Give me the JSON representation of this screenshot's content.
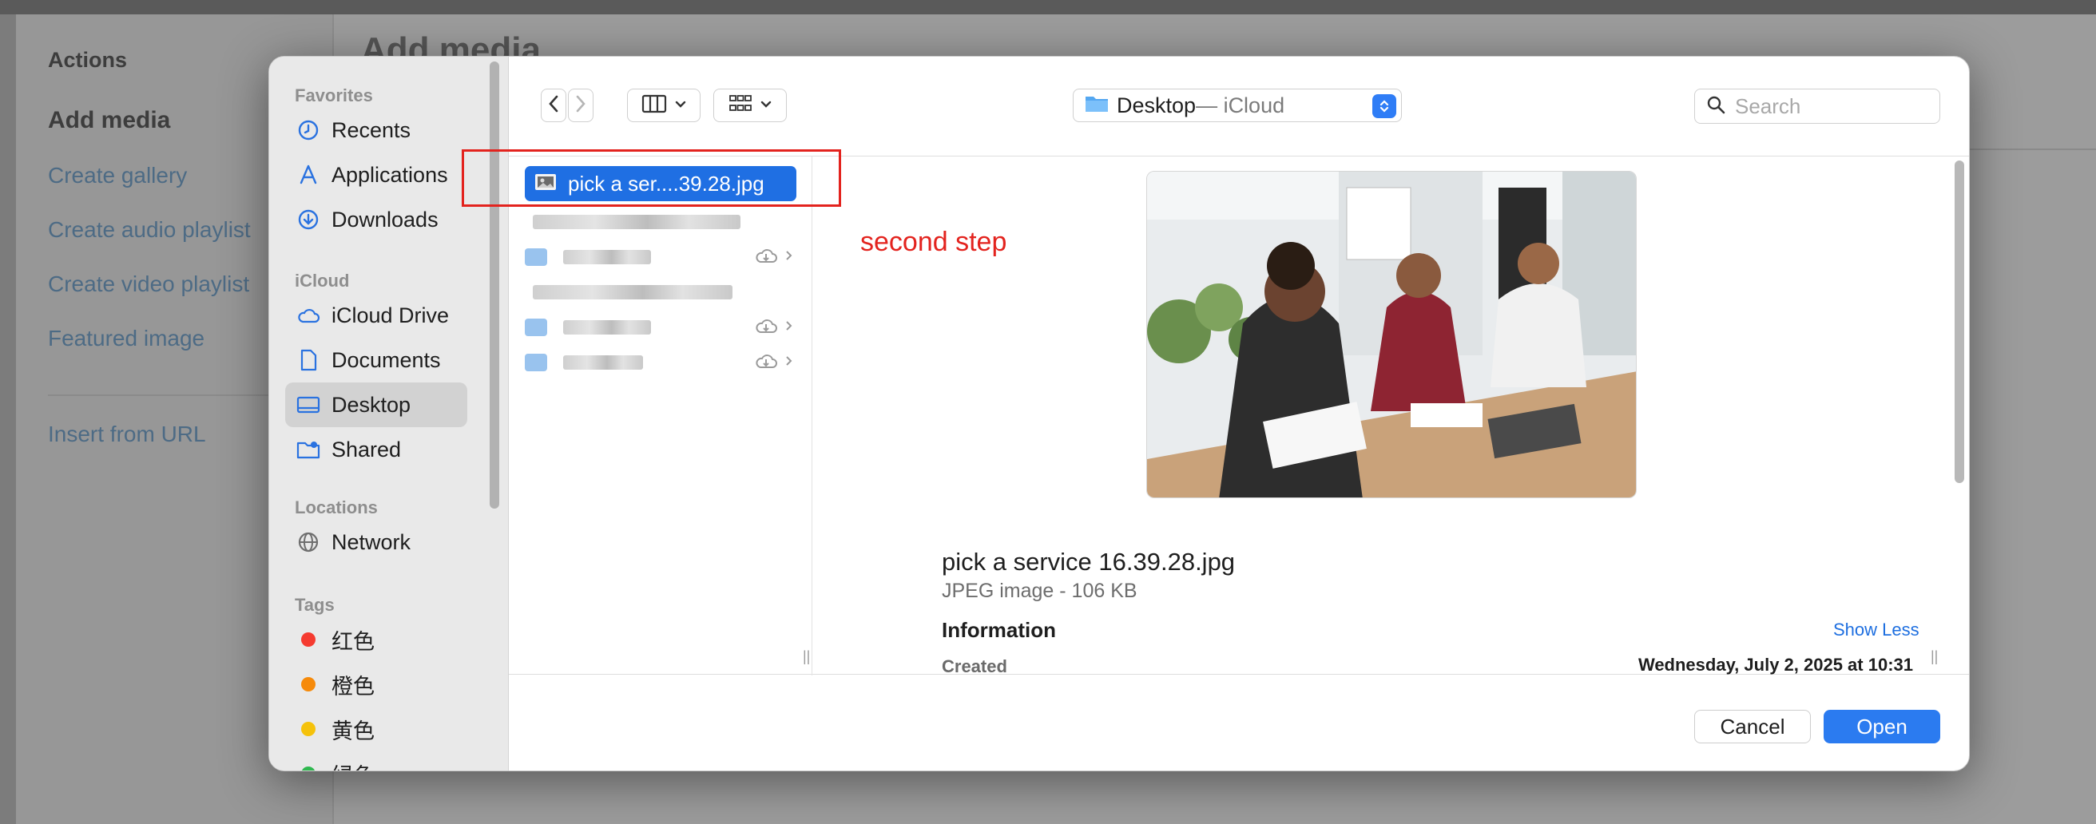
{
  "background": {
    "menu_heading": "Actions",
    "menu_items": [
      "Add media",
      "Create gallery",
      "Create audio playlist",
      "Create video playlist",
      "Featured image",
      "Insert from URL"
    ],
    "title": "Add media"
  },
  "dialog": {
    "sidebar": {
      "favorites_title": "Favorites",
      "favorites": [
        {
          "label": "Recents",
          "icon": "clock-icon"
        },
        {
          "label": "Applications",
          "icon": "applications-icon"
        },
        {
          "label": "Downloads",
          "icon": "download-icon"
        }
      ],
      "icloud_title": "iCloud",
      "icloud": [
        {
          "label": "iCloud Drive",
          "icon": "cloud-icon"
        },
        {
          "label": "Documents",
          "icon": "document-icon"
        },
        {
          "label": "Desktop",
          "icon": "desktop-icon",
          "selected": true
        },
        {
          "label": "Shared",
          "icon": "shared-folder-icon"
        }
      ],
      "locations_title": "Locations",
      "locations": [
        {
          "label": "Network",
          "icon": "globe-icon"
        }
      ],
      "tags_title": "Tags",
      "tags": [
        {
          "label": "红色",
          "color": "#f53b30"
        },
        {
          "label": "橙色",
          "color": "#f68a0a"
        },
        {
          "label": "黄色",
          "color": "#f5c20b"
        },
        {
          "label": "绿色",
          "color": "#2fb84f"
        }
      ]
    },
    "toolbar": {
      "location_name": "Desktop",
      "location_suffix": " — iCloud",
      "search_placeholder": "Search"
    },
    "files": {
      "selected_name": "pick a ser....39.28.jpg"
    },
    "preview": {
      "filename": "pick a service 16.39.28.jpg",
      "subtitle": "JPEG image - 106 KB",
      "info_heading": "Information",
      "show_less": "Show Less",
      "created_label": "Created",
      "created_value": "Wednesday, July 2, 2025 at 10:31"
    },
    "buttons": {
      "cancel": "Cancel",
      "open": "Open"
    }
  },
  "annotation": {
    "text": "second step",
    "color": "#e3231e"
  }
}
